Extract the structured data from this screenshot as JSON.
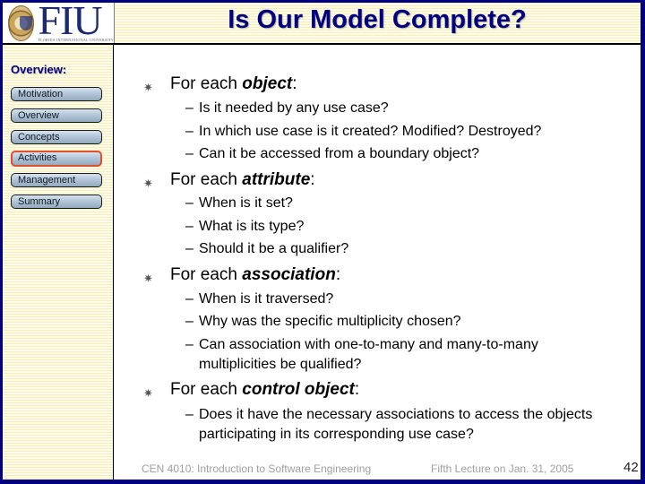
{
  "header": {
    "logo": {
      "acronym": "FIU",
      "subtitle": "FLORIDA INTERNATIONAL UNIVERSITY"
    },
    "title": "Is Our Model Complete?"
  },
  "sidebar": {
    "heading": "Overview:",
    "items": [
      {
        "label": "Motivation",
        "active": false
      },
      {
        "label": "Overview",
        "active": false
      },
      {
        "label": "Concepts",
        "active": false
      },
      {
        "label": "Activities",
        "active": true
      },
      {
        "label": "Management",
        "active": false
      },
      {
        "label": "Summary",
        "active": false
      }
    ],
    "active_color": "#e0502a"
  },
  "content": {
    "bullet_icon": "asterisk-bullet-icon",
    "sections": [
      {
        "prefix": "For each ",
        "emphasis": "object",
        "suffix": ":",
        "items": [
          "Is it needed by any use case?",
          "In which use case is it created? Modified? Destroyed?",
          "Can it be accessed from a boundary object?"
        ]
      },
      {
        "prefix": "For each ",
        "emphasis": "attribute",
        "suffix": ":",
        "items": [
          "When is it set?",
          "What is its type?",
          "Should it be a qualifier?"
        ]
      },
      {
        "prefix": "For each ",
        "emphasis": "association",
        "suffix": ":",
        "items": [
          "When is it traversed?",
          "Why was the specific multiplicity chosen?",
          "Can association with one-to-many and many-to-many multiplicities be qualified?"
        ]
      },
      {
        "prefix": "For each ",
        "emphasis": "control object",
        "suffix": ":",
        "items": [
          "Does it have the necessary associations to access the objects participating in its corresponding use case?"
        ]
      }
    ],
    "dash": "–",
    "bullet": "✷"
  },
  "footer": {
    "course": "CEN 4010: Introduction to Software Engineering",
    "lecture": "Fifth Lecture on Jan. 31, 2005",
    "page_number": "42"
  },
  "colors": {
    "frame": "#000080",
    "title": "#000080",
    "stripe_background": "#fbf9dc"
  }
}
